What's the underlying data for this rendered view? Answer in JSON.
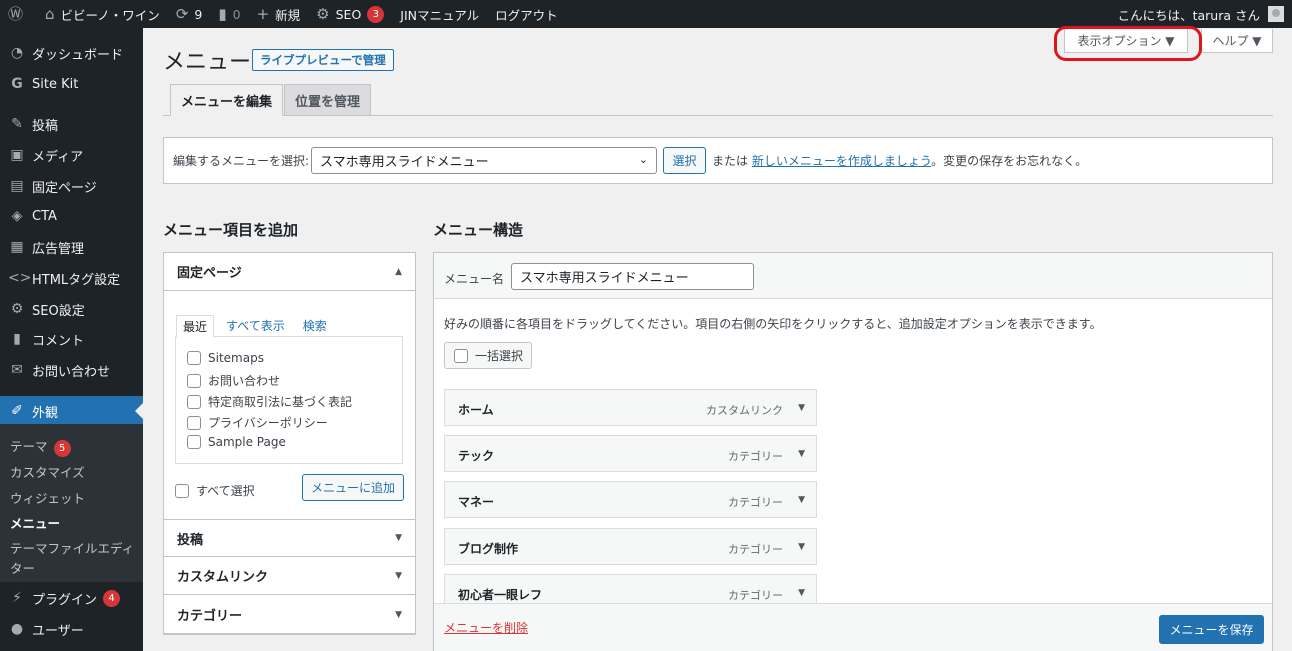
{
  "adminbar": {
    "site_name": "ビビーノ・ワイン",
    "updates_count": "9",
    "comments_count": "0",
    "new_label": "新規",
    "seo_label": "SEO",
    "seo_badge": "3",
    "jin_manual": "JINマニュアル",
    "logout": "ログアウト",
    "greeting": "こんにちは、tarura さん"
  },
  "sidebar": {
    "items": [
      {
        "label": "ダッシュボード",
        "icon": "dashboard-icon"
      },
      {
        "label": "Site Kit",
        "icon": "site-kit-icon"
      },
      {
        "label": "投稿",
        "icon": "posts-icon"
      },
      {
        "label": "メディア",
        "icon": "media-icon"
      },
      {
        "label": "固定ページ",
        "icon": "pages-icon"
      },
      {
        "label": "CTA",
        "icon": "cta-icon"
      },
      {
        "label": "広告管理",
        "icon": "ads-icon"
      },
      {
        "label": "HTMLタグ設定",
        "icon": "code-icon"
      },
      {
        "label": "SEO設定",
        "icon": "seo-settings-icon"
      },
      {
        "label": "コメント",
        "icon": "comments-icon"
      },
      {
        "label": "お問い合わせ",
        "icon": "mail-icon"
      },
      {
        "label": "外観",
        "icon": "appearance-icon"
      },
      {
        "label": "プラグイン",
        "icon": "plugins-icon",
        "badge": "4"
      },
      {
        "label": "ユーザー",
        "icon": "users-icon"
      }
    ],
    "submenu": {
      "themes": "テーマ",
      "themes_badge": "5",
      "customize": "カスタマイズ",
      "widgets": "ウィジェット",
      "menus": "メニュー",
      "theme_editor_1": "テーマファイルエディ",
      "theme_editor_2": "ター"
    }
  },
  "header": {
    "title": "メニュー",
    "live_preview": "ライブプレビューで管理",
    "screen_options": "表示オプション ▼",
    "help": "ヘルプ ▼"
  },
  "tabs": {
    "edit": "メニューを編集",
    "locations": "位置を管理"
  },
  "select_menu": {
    "label": "編集するメニューを選択:",
    "selected": "スマホ専用スライドメニュー",
    "select_button": "選択",
    "or_text": "または",
    "create_link": "新しいメニューを作成しましょう",
    "after_text": "。変更の保存をお忘れなく。"
  },
  "add_items": {
    "heading": "メニュー項目を追加",
    "pages_panel": "固定ページ",
    "sub_tabs": [
      "最近",
      "すべて表示",
      "検索"
    ],
    "pages": [
      "Sitemaps",
      "お問い合わせ",
      "特定商取引法に基づく表記",
      "プライバシーポリシー",
      "Sample Page"
    ],
    "select_all": "すべて選択",
    "add_button": "メニューに追加",
    "other_panels": [
      "投稿",
      "カスタムリンク",
      "カテゴリー"
    ]
  },
  "structure": {
    "heading": "メニュー構造",
    "name_label": "メニュー名",
    "name_value": "スマホ専用スライドメニュー",
    "instructions": "好みの順番に各項目をドラッグしてください。項目の右側の矢印をクリックすると、追加設定オプションを表示できます。",
    "bulk_select": "一括選択",
    "items": [
      {
        "title": "ホーム",
        "type": "カスタムリンク"
      },
      {
        "title": "テック",
        "type": "カテゴリー"
      },
      {
        "title": "マネー",
        "type": "カテゴリー"
      },
      {
        "title": "ブログ制作",
        "type": "カテゴリー"
      },
      {
        "title": "初心者一眼レフ",
        "type": "カテゴリー"
      }
    ],
    "delete_link": "メニューを削除",
    "save_button": "メニューを保存"
  }
}
